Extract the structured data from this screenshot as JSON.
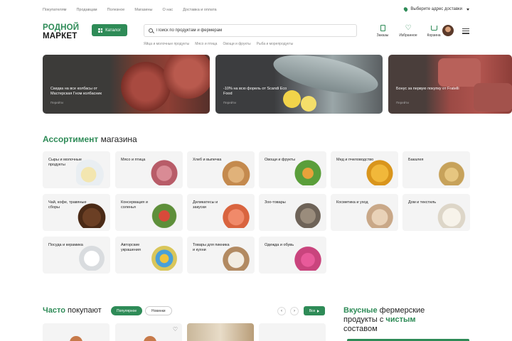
{
  "topnav": [
    "Покупателям",
    "Продавцам",
    "Полезное",
    "Магазины",
    "О нас",
    "Доставка и оплата"
  ],
  "delivery": "Выберите адрес доставки",
  "logo": {
    "line1": "РОДНОЙ",
    "line2": "МАРКЕТ"
  },
  "catalog": "Каталог",
  "search": {
    "placeholder": "Поиск по продуктам и фермерам"
  },
  "quicklinks": [
    "Яйца и молочные продукты",
    "Мясо и птица",
    "Овощи и фрукты",
    "Рыба и морепродукты"
  ],
  "header_icons": [
    {
      "label": "Заказы",
      "icon": "orders-icon"
    },
    {
      "label": "Избранное",
      "icon": "heart-icon"
    },
    {
      "label": "Корзина",
      "icon": "cart-icon"
    }
  ],
  "banners": [
    {
      "text": "Скидка на все колбасы от Мастерская Гном колбасник",
      "more": "Перейти"
    },
    {
      "text": "-10% на всю форель от Scandi Eco Food",
      "more": "Перейти"
    },
    {
      "text": "Бонус за первую покупку от Fratelli",
      "more": "Перейти"
    }
  ],
  "assortment": {
    "title_bold": "Ассортимент",
    "title_rest": "магазина"
  },
  "categories": [
    {
      "label": "Сыры и молочные продукты"
    },
    {
      "label": "Мясо и птица"
    },
    {
      "label": "Хлеб и выпечка"
    },
    {
      "label": "Овощи и фрукты"
    },
    {
      "label": "Мед и пчеловодство"
    },
    {
      "label": "Бакалея"
    },
    {
      "label": "Чай, кофе, травяные сборы"
    },
    {
      "label": "Консервация и соленья"
    },
    {
      "label": "Деликатесы и закуски"
    },
    {
      "label": "Зоо-товары"
    },
    {
      "label": "Косметика и уход"
    },
    {
      "label": "Дом и текстиль"
    },
    {
      "label": "Посуда и керамика"
    },
    {
      "label": "Авторские украшения"
    },
    {
      "label": "Товары для пикника и кухни"
    },
    {
      "label": "Одежда и обувь"
    }
  ],
  "often": {
    "title_bold": "Часто",
    "title_rest": "покупают",
    "tab_active": "Популярное",
    "tab_inactive": "Новинки",
    "prev": "‹",
    "next": "›",
    "all": "Все"
  },
  "farm": {
    "w1": "Вкусные",
    "w2": "фермерские продукты",
    "w3": "с",
    "w4": "чистым",
    "w5": "составом"
  },
  "colors": {
    "accent": "#2e8b57"
  }
}
